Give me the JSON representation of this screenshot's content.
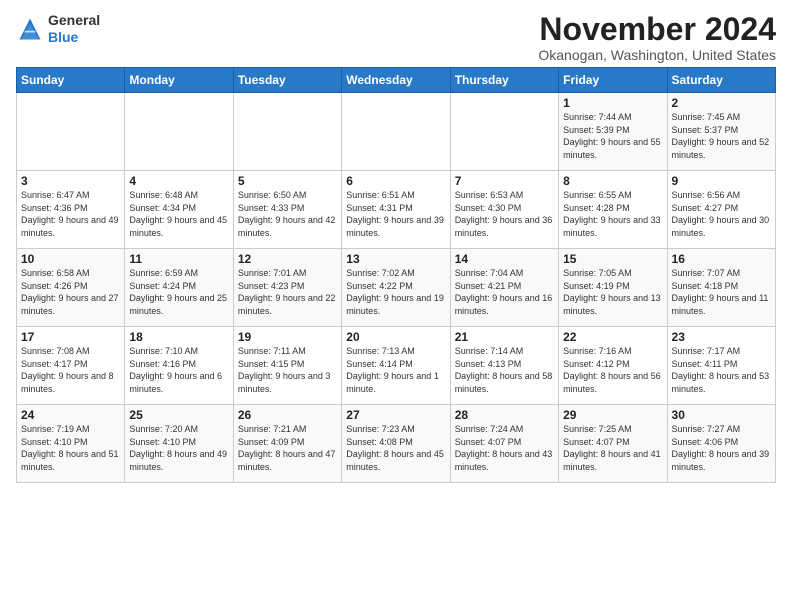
{
  "logo": {
    "general": "General",
    "blue": "Blue"
  },
  "title": "November 2024",
  "subtitle": "Okanogan, Washington, United States",
  "days_of_week": [
    "Sunday",
    "Monday",
    "Tuesday",
    "Wednesday",
    "Thursday",
    "Friday",
    "Saturday"
  ],
  "weeks": [
    [
      {
        "day": "",
        "info": ""
      },
      {
        "day": "",
        "info": ""
      },
      {
        "day": "",
        "info": ""
      },
      {
        "day": "",
        "info": ""
      },
      {
        "day": "",
        "info": ""
      },
      {
        "day": "1",
        "info": "Sunrise: 7:44 AM\nSunset: 5:39 PM\nDaylight: 9 hours and 55 minutes."
      },
      {
        "day": "2",
        "info": "Sunrise: 7:45 AM\nSunset: 5:37 PM\nDaylight: 9 hours and 52 minutes."
      }
    ],
    [
      {
        "day": "3",
        "info": "Sunrise: 6:47 AM\nSunset: 4:36 PM\nDaylight: 9 hours and 49 minutes."
      },
      {
        "day": "4",
        "info": "Sunrise: 6:48 AM\nSunset: 4:34 PM\nDaylight: 9 hours and 45 minutes."
      },
      {
        "day": "5",
        "info": "Sunrise: 6:50 AM\nSunset: 4:33 PM\nDaylight: 9 hours and 42 minutes."
      },
      {
        "day": "6",
        "info": "Sunrise: 6:51 AM\nSunset: 4:31 PM\nDaylight: 9 hours and 39 minutes."
      },
      {
        "day": "7",
        "info": "Sunrise: 6:53 AM\nSunset: 4:30 PM\nDaylight: 9 hours and 36 minutes."
      },
      {
        "day": "8",
        "info": "Sunrise: 6:55 AM\nSunset: 4:28 PM\nDaylight: 9 hours and 33 minutes."
      },
      {
        "day": "9",
        "info": "Sunrise: 6:56 AM\nSunset: 4:27 PM\nDaylight: 9 hours and 30 minutes."
      }
    ],
    [
      {
        "day": "10",
        "info": "Sunrise: 6:58 AM\nSunset: 4:26 PM\nDaylight: 9 hours and 27 minutes."
      },
      {
        "day": "11",
        "info": "Sunrise: 6:59 AM\nSunset: 4:24 PM\nDaylight: 9 hours and 25 minutes."
      },
      {
        "day": "12",
        "info": "Sunrise: 7:01 AM\nSunset: 4:23 PM\nDaylight: 9 hours and 22 minutes."
      },
      {
        "day": "13",
        "info": "Sunrise: 7:02 AM\nSunset: 4:22 PM\nDaylight: 9 hours and 19 minutes."
      },
      {
        "day": "14",
        "info": "Sunrise: 7:04 AM\nSunset: 4:21 PM\nDaylight: 9 hours and 16 minutes."
      },
      {
        "day": "15",
        "info": "Sunrise: 7:05 AM\nSunset: 4:19 PM\nDaylight: 9 hours and 13 minutes."
      },
      {
        "day": "16",
        "info": "Sunrise: 7:07 AM\nSunset: 4:18 PM\nDaylight: 9 hours and 11 minutes."
      }
    ],
    [
      {
        "day": "17",
        "info": "Sunrise: 7:08 AM\nSunset: 4:17 PM\nDaylight: 9 hours and 8 minutes."
      },
      {
        "day": "18",
        "info": "Sunrise: 7:10 AM\nSunset: 4:16 PM\nDaylight: 9 hours and 6 minutes."
      },
      {
        "day": "19",
        "info": "Sunrise: 7:11 AM\nSunset: 4:15 PM\nDaylight: 9 hours and 3 minutes."
      },
      {
        "day": "20",
        "info": "Sunrise: 7:13 AM\nSunset: 4:14 PM\nDaylight: 9 hours and 1 minute."
      },
      {
        "day": "21",
        "info": "Sunrise: 7:14 AM\nSunset: 4:13 PM\nDaylight: 8 hours and 58 minutes."
      },
      {
        "day": "22",
        "info": "Sunrise: 7:16 AM\nSunset: 4:12 PM\nDaylight: 8 hours and 56 minutes."
      },
      {
        "day": "23",
        "info": "Sunrise: 7:17 AM\nSunset: 4:11 PM\nDaylight: 8 hours and 53 minutes."
      }
    ],
    [
      {
        "day": "24",
        "info": "Sunrise: 7:19 AM\nSunset: 4:10 PM\nDaylight: 8 hours and 51 minutes."
      },
      {
        "day": "25",
        "info": "Sunrise: 7:20 AM\nSunset: 4:10 PM\nDaylight: 8 hours and 49 minutes."
      },
      {
        "day": "26",
        "info": "Sunrise: 7:21 AM\nSunset: 4:09 PM\nDaylight: 8 hours and 47 minutes."
      },
      {
        "day": "27",
        "info": "Sunrise: 7:23 AM\nSunset: 4:08 PM\nDaylight: 8 hours and 45 minutes."
      },
      {
        "day": "28",
        "info": "Sunrise: 7:24 AM\nSunset: 4:07 PM\nDaylight: 8 hours and 43 minutes."
      },
      {
        "day": "29",
        "info": "Sunrise: 7:25 AM\nSunset: 4:07 PM\nDaylight: 8 hours and 41 minutes."
      },
      {
        "day": "30",
        "info": "Sunrise: 7:27 AM\nSunset: 4:06 PM\nDaylight: 8 hours and 39 minutes."
      }
    ]
  ]
}
